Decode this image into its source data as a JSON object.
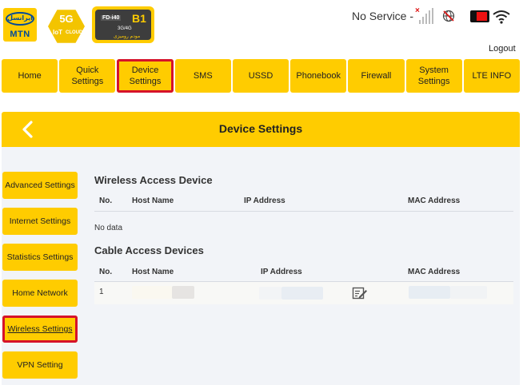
{
  "branding": {
    "mtn_persian": "ایرانسل",
    "mtn": "MTN",
    "fiveg": "5G",
    "iot": "IoT",
    "cloud": "CLOUD",
    "model_code": "FD-i40",
    "model_band": "B1",
    "model_gen": "3G/4G",
    "model_persian": "مودم رومیزی"
  },
  "status": {
    "network": "No Service -",
    "signal_icon": "signal-bars-icon",
    "sim_icon": "globe-blocked-icon",
    "battery_icon": "battery-icon",
    "wifi_icon": "wifi-icon"
  },
  "header": {
    "logout": "Logout"
  },
  "nav": {
    "items": [
      {
        "label": "Home"
      },
      {
        "label": "Quick Settings"
      },
      {
        "label": "Device Settings"
      },
      {
        "label": "SMS"
      },
      {
        "label": "USSD"
      },
      {
        "label": "Phonebook"
      },
      {
        "label": "Firewall"
      },
      {
        "label": "System Settings"
      },
      {
        "label": "LTE INFO"
      }
    ],
    "active": "Device Settings"
  },
  "page": {
    "title": "Device Settings",
    "back_icon": "chevron-left-icon"
  },
  "side_menu": {
    "items": [
      {
        "label": "Advanced Settings"
      },
      {
        "label": "Internet Settings"
      },
      {
        "label": "Statistics Settings"
      },
      {
        "label": "Home Network"
      },
      {
        "label": "Wireless Settings"
      },
      {
        "label": "VPN Setting"
      }
    ],
    "active": "Wireless Settings"
  },
  "wireless": {
    "title": "Wireless Access Device",
    "columns": {
      "no": "No.",
      "host": "Host Name",
      "ip": "IP Address",
      "mac": "MAC Address"
    },
    "empty": "No data"
  },
  "cable": {
    "title": "Cable Access Devices",
    "columns": {
      "no": "No.",
      "host": "Host Name",
      "ip": "IP Address",
      "mac": "MAC Address"
    },
    "rows": [
      {
        "no": "1"
      }
    ],
    "edit_icon": "edit-icon"
  },
  "colors": {
    "accent": "#ffcc00",
    "highlight": "#d6122a",
    "content_bg": "#f2f4f8"
  }
}
